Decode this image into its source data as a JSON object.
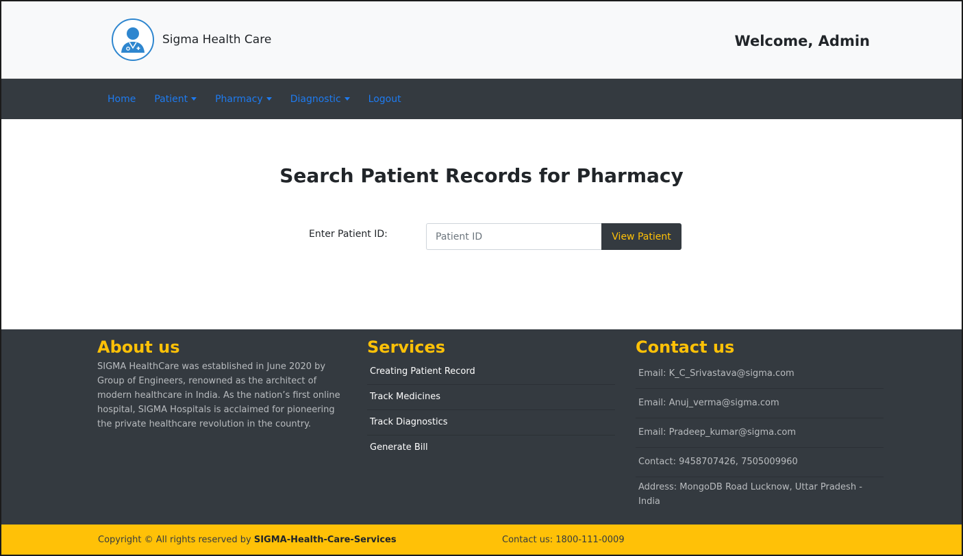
{
  "header": {
    "brand_name": "Sigma Health Care",
    "welcome": "Welcome, Admin",
    "logo_icon": "doctor-avatar-icon"
  },
  "nav": {
    "items": [
      {
        "label": "Home",
        "dropdown": false
      },
      {
        "label": "Patient",
        "dropdown": true
      },
      {
        "label": "Pharmacy",
        "dropdown": true
      },
      {
        "label": "Diagnostic",
        "dropdown": true
      },
      {
        "label": "Logout",
        "dropdown": false
      }
    ]
  },
  "main": {
    "title": "Search Patient Records for Pharmacy",
    "label": "Enter Patient ID:",
    "input_value": "",
    "input_placeholder": "Patient ID",
    "button_label": "View Patient"
  },
  "footer": {
    "about": {
      "title": "About us",
      "text": "SIGMA HealthCare was established in June 2020 by Group of Engineers, renowned as the architect of modern healthcare in India. As the nation’s first online hospital, SIGMA Hospitals is acclaimed for pioneering the private healthcare revolution in the country."
    },
    "services": {
      "title": "Services",
      "items": [
        "Creating Patient Record",
        "Track Medicines",
        "Track Diagnostics",
        "Generate Bill"
      ]
    },
    "contact": {
      "title": "Contact us",
      "items": [
        "Email: K_C_Srivastava@sigma.com",
        "Email: Anuj_verma@sigma.com",
        "Email: Pradeep_kumar@sigma.com",
        "Contact: 9458707426, 7505009960",
        "Address: MongoDB Road Lucknow, Uttar Pradesh - India"
      ]
    }
  },
  "copyright": {
    "prefix": "Copyright © All rights reserved by",
    "company": "SIGMA-Health-Care-Services",
    "contact": "Contact us: 1800-111-0009"
  },
  "colors": {
    "nav_bg": "#343a40",
    "accent": "#ffc107",
    "link": "#1e7bf0",
    "logo_blue": "#2e86cf"
  }
}
